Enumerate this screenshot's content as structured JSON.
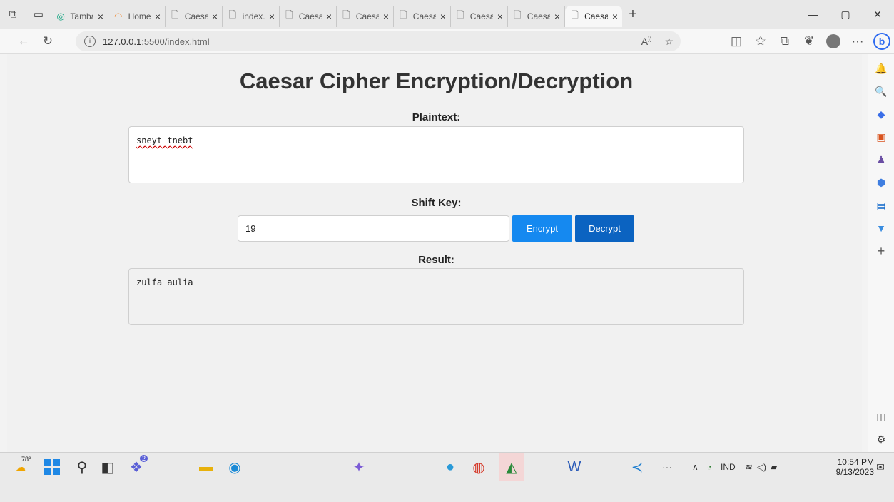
{
  "browser": {
    "tabs": [
      {
        "title": "Tamba",
        "icon": "chatgpt-icon"
      },
      {
        "title": "Home",
        "icon": "loading-icon"
      },
      {
        "title": "Caesa",
        "icon": "page-icon"
      },
      {
        "title": "index.",
        "icon": "page-icon"
      },
      {
        "title": "Caesa",
        "icon": "page-icon"
      },
      {
        "title": "Caesa",
        "icon": "page-icon"
      },
      {
        "title": "Caesa",
        "icon": "page-icon"
      },
      {
        "title": "Caesa",
        "icon": "page-icon"
      },
      {
        "title": "Caesa",
        "icon": "page-icon"
      },
      {
        "title": "Caesa",
        "icon": "page-icon",
        "active": true
      }
    ],
    "url_host": "127.0.0.1",
    "url_path": ":5500/index.html"
  },
  "page": {
    "title": "Caesar Cipher Encryption/Decryption",
    "plaintext_label": "Plaintext:",
    "plaintext_value": "sneyt tnebt",
    "shift_label": "Shift Key:",
    "shift_value": "19",
    "encrypt_label": "Encrypt",
    "decrypt_label": "Decrypt",
    "result_label": "Result:",
    "result_value": "zulfa aulia"
  },
  "taskbar": {
    "weather_temp": "78°",
    "notify_count": "2",
    "language": "IND",
    "time": "10:54 PM",
    "date": "9/13/2023"
  },
  "colors": {
    "encrypt_button": "#1589f0",
    "decrypt_button": "#0b63c1"
  }
}
